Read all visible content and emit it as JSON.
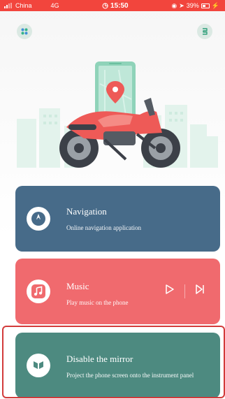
{
  "status_bar": {
    "carrier": "China",
    "network": "4G",
    "time": "15:50",
    "battery": "39%"
  },
  "icons": {
    "menu": "grid-icon",
    "right": "bracket-icon"
  },
  "cards": {
    "navigation": {
      "title": "Navigation",
      "subtitle": "Online navigation application",
      "color": "#476b89"
    },
    "music": {
      "title": "Music",
      "subtitle": "Play music on the phone",
      "color": "#f06a6e"
    },
    "mirror": {
      "title": "Disable the mirror",
      "subtitle": "Project the phone screen onto the instrument panel",
      "color": "#4d8a80"
    }
  },
  "colors": {
    "status_bar": "#f2453d",
    "accent_red": "#ee5a57",
    "accent_green": "#9cd4bf"
  }
}
